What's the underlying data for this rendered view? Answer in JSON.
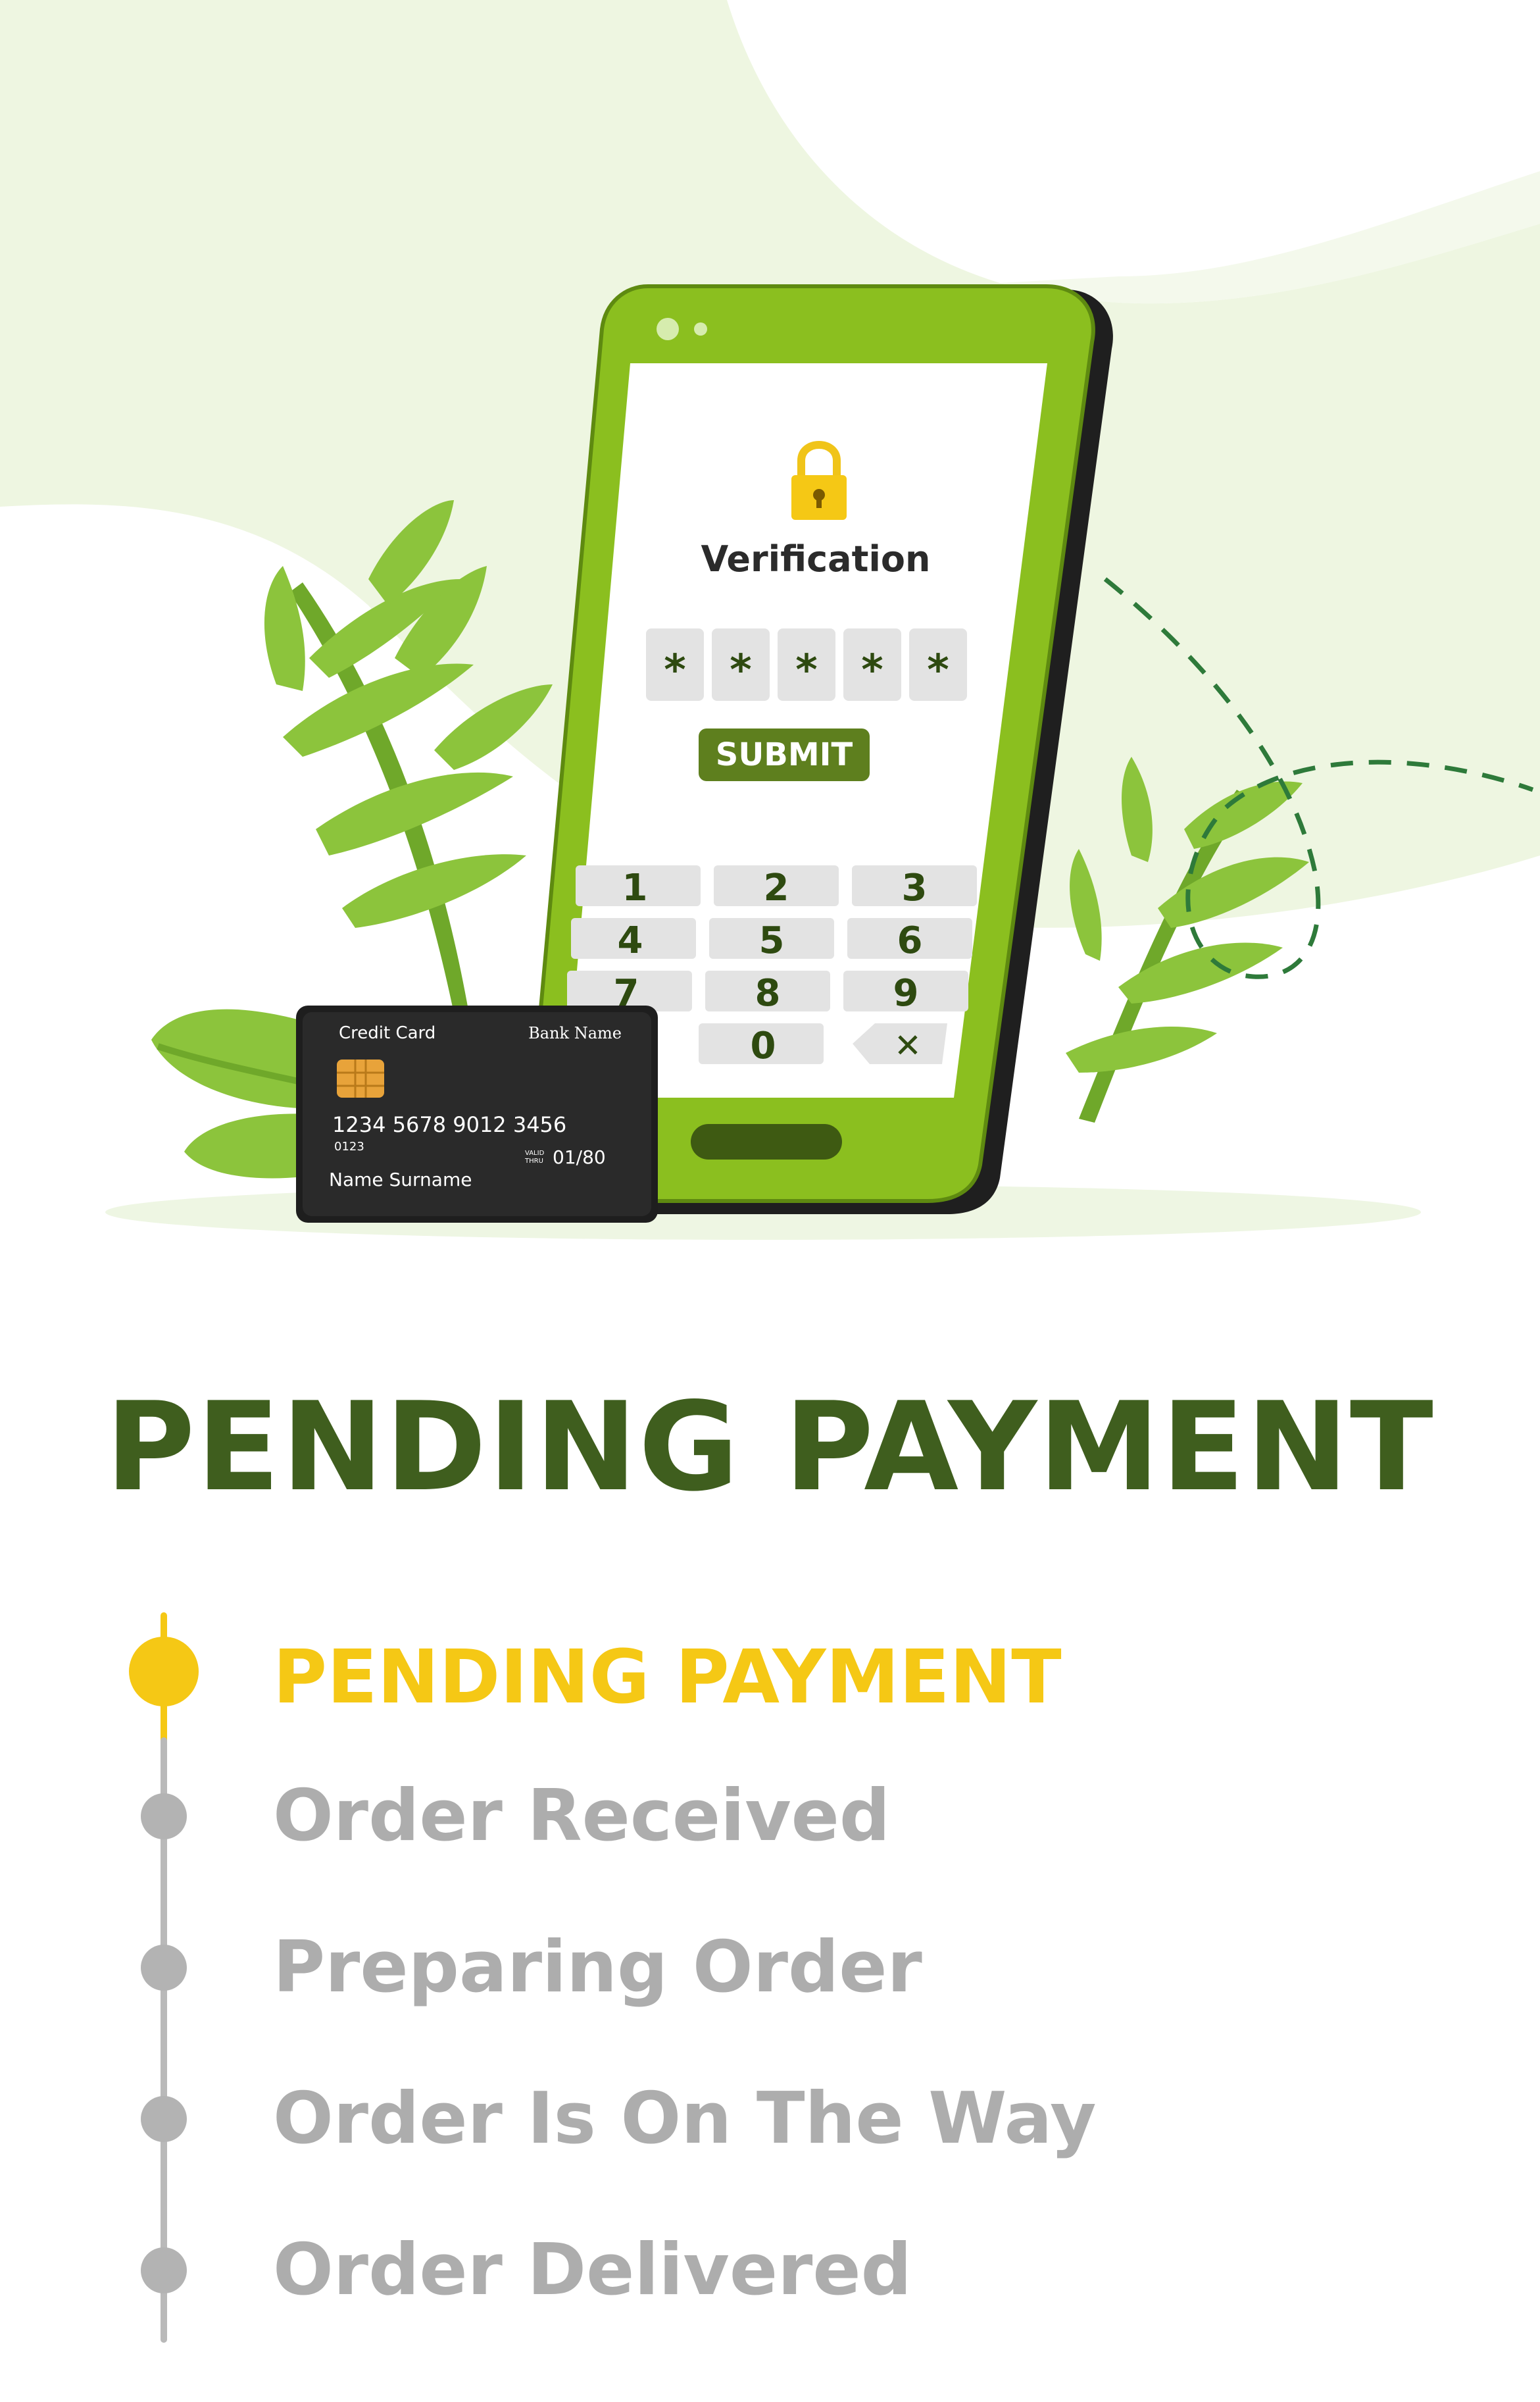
{
  "phone": {
    "screen_title": "Verification",
    "pin_mask": [
      "*",
      "*",
      "*",
      "*",
      "*"
    ],
    "submit_label": "SUBMIT",
    "keypad": [
      "1",
      "2",
      "3",
      "4",
      "5",
      "6",
      "7",
      "8",
      "9",
      "0"
    ],
    "delete_glyph": "✕"
  },
  "card": {
    "label": "Credit Card",
    "bank": "Bank Name",
    "number": "1234  5678  9012  3456",
    "small_number": "0123",
    "valid_label_1": "VALID",
    "valid_label_2": "THRU",
    "expiry": "01/80",
    "holder": "Name Surname"
  },
  "page_title": "PENDING PAYMENT",
  "steps": [
    {
      "label": "PENDING PAYMENT",
      "active": true
    },
    {
      "label": "Order Received",
      "active": false
    },
    {
      "label": "Preparing Order",
      "active": false
    },
    {
      "label": "Order Is On The Way",
      "active": false
    },
    {
      "label": "Order Delivered",
      "active": false
    }
  ],
  "colors": {
    "brand_dark_green": "#3f5e1e",
    "phone_green": "#8bbf1f",
    "active_yellow": "#f5c815",
    "inactive_gray": "#adadad",
    "blob_green": "#eef6e1"
  }
}
